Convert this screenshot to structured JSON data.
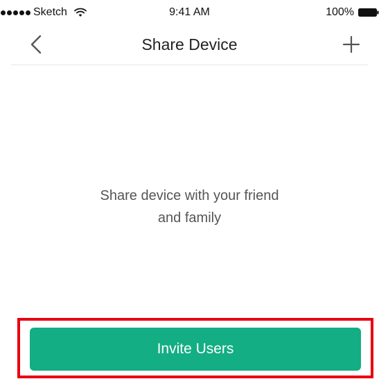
{
  "status_bar": {
    "carrier": "Sketch",
    "time": "9:41 AM",
    "battery_percent": "100%",
    "icons": {
      "signal": "signal-dots-icon",
      "wifi": "wifi-icon",
      "battery": "battery-icon"
    }
  },
  "nav": {
    "title": "Share Device",
    "back_icon": "chevron-left-icon",
    "add_icon": "plus-icon"
  },
  "empty_state": {
    "line1": "Share device with your friend",
    "line2": "and family"
  },
  "actions": {
    "invite_label": "Invite Users"
  },
  "colors": {
    "accent": "#13ae83",
    "highlight": "#e8000f"
  }
}
